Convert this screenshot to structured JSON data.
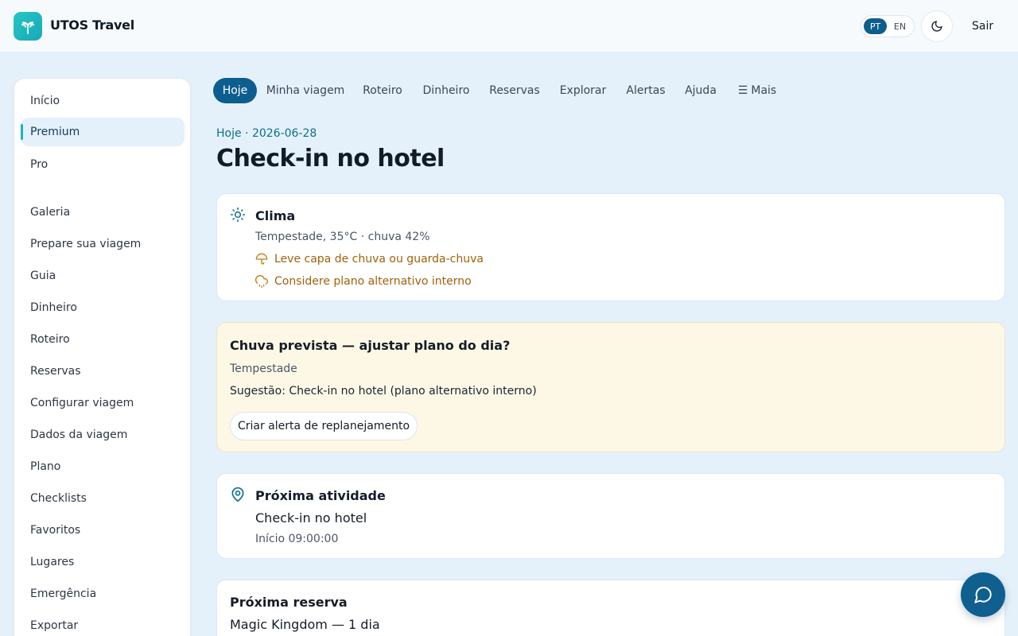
{
  "app": {
    "brand": "UTOS Travel",
    "logo_icon": "palm-tree-icon",
    "accent": "#0d5e8e",
    "teal": "#17b4c2"
  },
  "header": {
    "lang_options": [
      "PT",
      "EN"
    ],
    "lang_selected": "PT",
    "theme_icon": "moon-icon",
    "logout_label": "Sair"
  },
  "sidebar": {
    "items": [
      {
        "label": "Início",
        "active": false
      },
      {
        "label": "Premium",
        "active": true
      },
      {
        "label": "Pro",
        "active": false
      },
      {
        "label": "Galeria",
        "active": false
      },
      {
        "label": "Prepare sua viagem",
        "active": false
      },
      {
        "label": "Guia",
        "active": false
      },
      {
        "label": "Dinheiro",
        "active": false
      },
      {
        "label": "Roteiro",
        "active": false
      },
      {
        "label": "Reservas",
        "active": false
      },
      {
        "label": "Configurar viagem",
        "active": false
      },
      {
        "label": "Dados da viagem",
        "active": false
      },
      {
        "label": "Plano",
        "active": false
      },
      {
        "label": "Checklists",
        "active": false
      },
      {
        "label": "Favoritos",
        "active": false
      },
      {
        "label": "Lugares",
        "active": false
      },
      {
        "label": "Emergência",
        "active": false
      },
      {
        "label": "Exportar",
        "active": false
      }
    ]
  },
  "tabs": [
    {
      "label": "Hoje",
      "active": true
    },
    {
      "label": "Minha viagem",
      "active": false
    },
    {
      "label": "Roteiro",
      "active": false
    },
    {
      "label": "Dinheiro",
      "active": false
    },
    {
      "label": "Reservas",
      "active": false
    },
    {
      "label": "Explorar",
      "active": false
    },
    {
      "label": "Alertas",
      "active": false
    },
    {
      "label": "Ajuda",
      "active": false
    },
    {
      "label": "Mais",
      "active": false,
      "icon": "menu-icon"
    }
  ],
  "page": {
    "breadcrumb": "Hoje · 2026-06-28",
    "title": "Check-in no hotel"
  },
  "weather": {
    "icon": "sun-icon",
    "title": "Clima",
    "summary": "Tempestade, 35°C · chuva 42%",
    "tips": [
      {
        "icon": "umbrella-icon",
        "text": "Leve capa de chuva ou guarda-chuva"
      },
      {
        "icon": "rain-cloud-icon",
        "text": "Considere plano alternativo interno"
      }
    ],
    "tip_color": "#a0610b"
  },
  "rain_alert": {
    "title": "Chuva prevista — ajustar plano do dia?",
    "condition": "Tempestade",
    "suggestion": "Sugestão: Check-in no hotel (plano alternativo interno)",
    "button_label": "Criar alerta de replanejamento",
    "bg_color": "#fdf8e6"
  },
  "next_activity": {
    "icon": "map-pin-icon",
    "title": "Próxima atividade",
    "name": "Check-in no hotel",
    "start": "Início 09:00:00"
  },
  "next_booking": {
    "title": "Próxima reserva",
    "name": "Magic Kingdom — 1 dia"
  },
  "chat": {
    "icon": "chat-bubble-icon"
  }
}
